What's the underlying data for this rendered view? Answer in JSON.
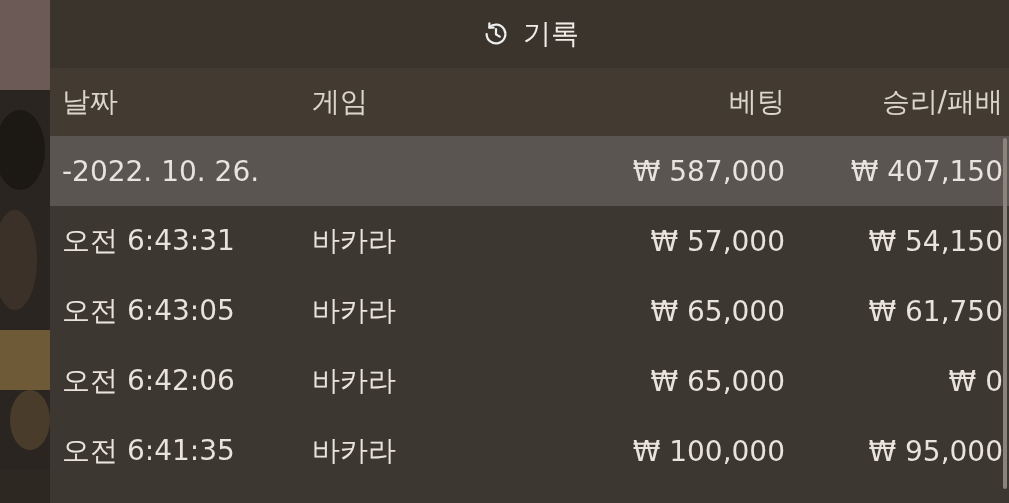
{
  "title": "기록",
  "columns": [
    "날짜",
    "게임",
    "베팅",
    "승리/패배"
  ],
  "groups": [
    {
      "date": "-2022. 10. 26.",
      "bet": "₩ 587,000",
      "result": "₩ 407,150",
      "rows": [
        {
          "time": "오전 6:43:31",
          "game": "바카라",
          "bet": "₩ 57,000",
          "result": "₩ 54,150"
        },
        {
          "time": "오전 6:43:05",
          "game": "바카라",
          "bet": "₩ 65,000",
          "result": "₩ 61,750"
        },
        {
          "time": "오전 6:42:06",
          "game": "바카라",
          "bet": "₩ 65,000",
          "result": "₩ 0"
        },
        {
          "time": "오전 6:41:35",
          "game": "바카라",
          "bet": "₩ 100,000",
          "result": "₩ 95,000"
        }
      ]
    }
  ]
}
